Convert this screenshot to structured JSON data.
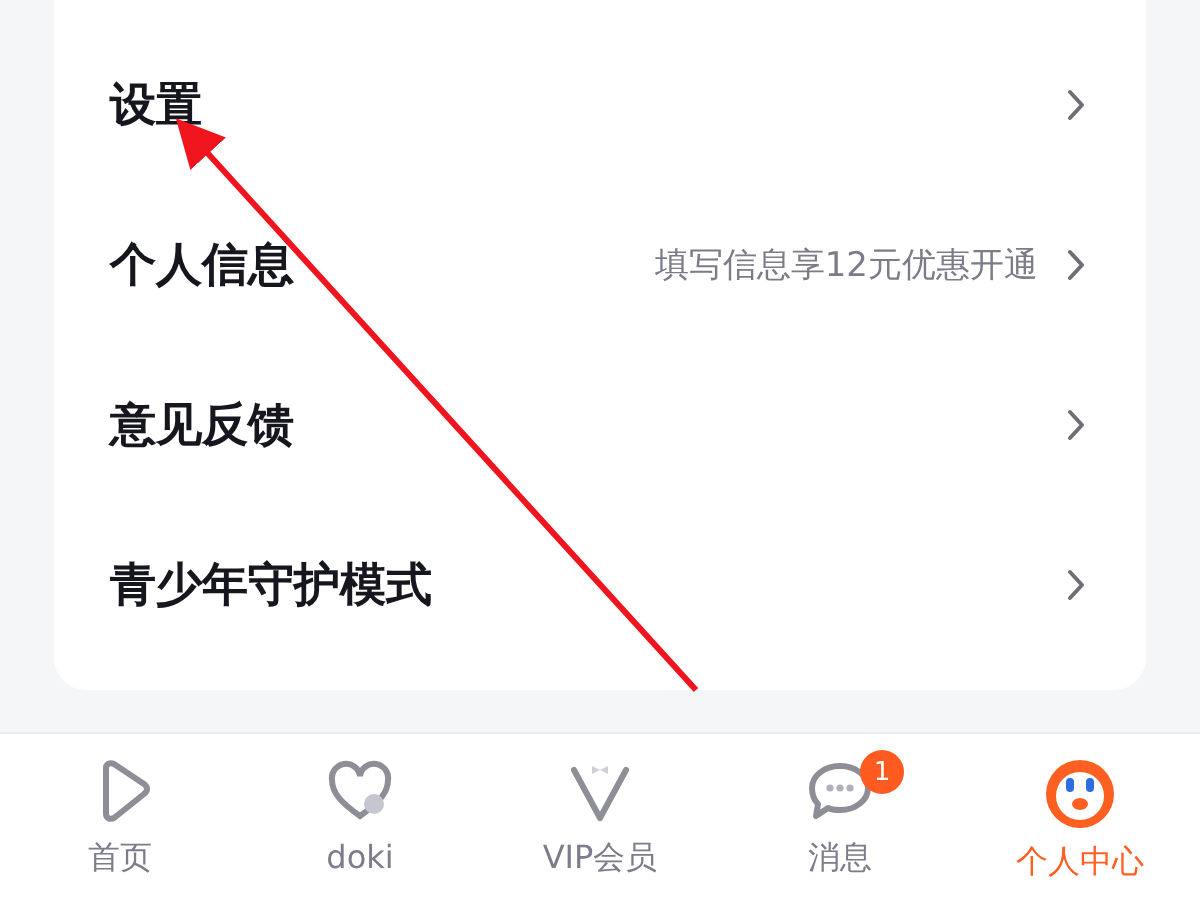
{
  "menu": [
    {
      "label": "设置"
    },
    {
      "label": "个人信息",
      "hint": "填写信息享12元优惠开通"
    },
    {
      "label": "意见反馈"
    },
    {
      "label": "青少年守护模式"
    }
  ],
  "tab_bar": [
    {
      "kind": "home",
      "label": "首页",
      "selected": false
    },
    {
      "kind": "doki",
      "label": "doki",
      "selected": false
    },
    {
      "kind": "vip",
      "label": "VIP会员",
      "selected": false
    },
    {
      "kind": "messages",
      "label": "消息",
      "selected": false,
      "badge": "1"
    },
    {
      "kind": "profile",
      "label": "个人中心",
      "selected": true
    }
  ]
}
